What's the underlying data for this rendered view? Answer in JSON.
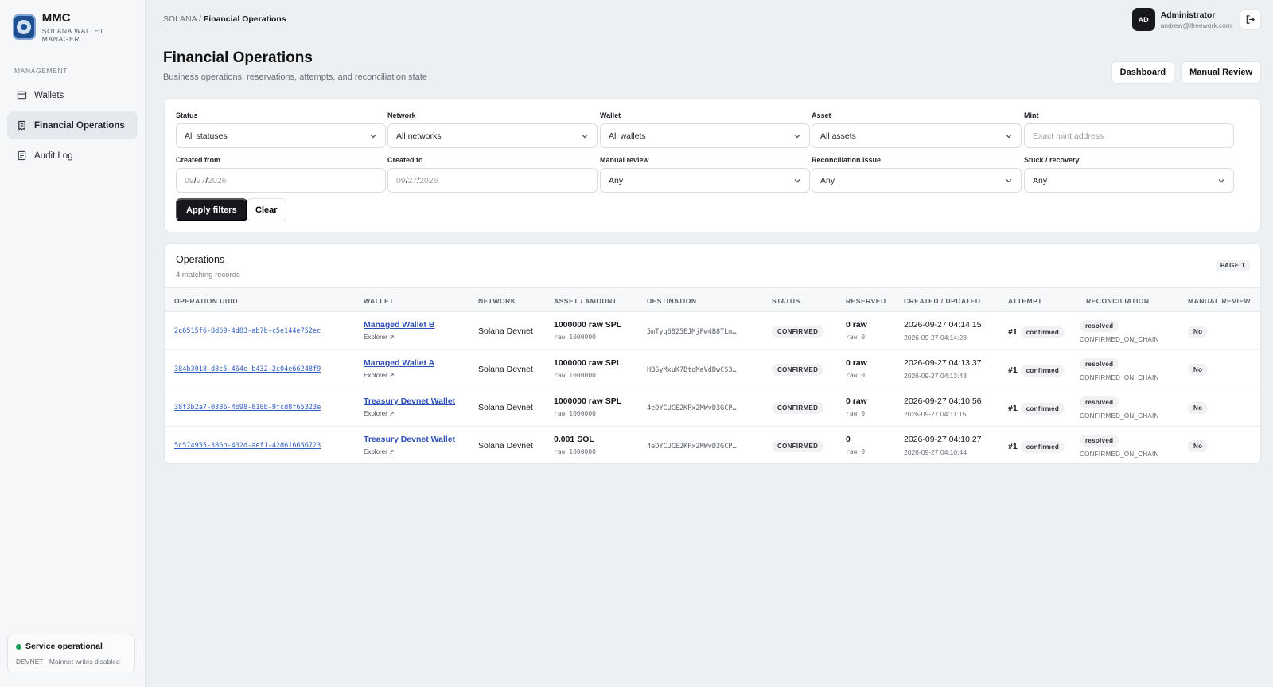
{
  "brand": {
    "title": "MMC",
    "subtitle": "SOLANA WALLET MANAGER"
  },
  "sidebar": {
    "section_label": "MANAGEMENT",
    "items": [
      {
        "label": "Wallets",
        "icon": "wallet-icon",
        "active": false
      },
      {
        "label": "Financial Operations",
        "icon": "receipt-icon",
        "active": true
      },
      {
        "label": "Audit Log",
        "icon": "document-icon",
        "active": false
      }
    ],
    "status": {
      "title": "Service operational",
      "subtitle": "DEVNET · Mainnet writes disabled",
      "color": "#1e9e5a"
    }
  },
  "topbar": {
    "breadcrumb_root": "SOLANA",
    "breadcrumb_sep": " / ",
    "breadcrumb_current": "Financial Operations",
    "user": {
      "initials": "AD",
      "name": "Administrator",
      "email": "andrew@ifreework.com"
    }
  },
  "header": {
    "title": "Financial Operations",
    "subtitle": "Business operations, reservations, attempts, and reconciliation state",
    "dashboard_label": "Dashboard",
    "manual_review_label": "Manual Review"
  },
  "filters": {
    "status": {
      "label": "Status",
      "value": "All statuses"
    },
    "network": {
      "label": "Network",
      "value": "All networks"
    },
    "wallet": {
      "label": "Wallet",
      "value": "All wallets"
    },
    "asset": {
      "label": "Asset",
      "value": "All assets"
    },
    "mint": {
      "label": "Mint",
      "placeholder": "Exact mint address"
    },
    "created_from": {
      "label": "Created from",
      "mm": "09",
      "dd": "27",
      "yyyy": "2026",
      "sep": "/"
    },
    "created_to": {
      "label": "Created to",
      "mm": "09",
      "dd": "27",
      "yyyy": "2026",
      "sep": "/"
    },
    "manual_review": {
      "label": "Manual review",
      "value": "Any"
    },
    "reconciliation_issue": {
      "label": "Reconciliation issue",
      "value": "Any"
    },
    "stuck_recovery": {
      "label": "Stuck / recovery",
      "value": "Any"
    },
    "apply_label": "Apply filters",
    "clear_label": "Clear"
  },
  "operations": {
    "title": "Operations",
    "count_text": "4 matching records",
    "page_label": "PAGE 1",
    "columns": [
      "OPERATION UUID",
      "WALLET",
      "NETWORK",
      "ASSET / AMOUNT",
      "DESTINATION",
      "STATUS",
      "RESERVED",
      "CREATED / UPDATED",
      "ATTEMPT",
      "RECONCILIATION",
      "MANUAL REVIEW"
    ],
    "explorer_label": "Explorer ↗",
    "rows": [
      {
        "uuid": "2c6515f6-8d69-4d83-ab7b-c5e144e752ec",
        "wallet": "Managed Wallet B",
        "network": "Solana Devnet",
        "amount": "1000000 raw SPL",
        "raw": "raw 1000000",
        "destination": "5mTyq6825EJMjPw4B8TLm…",
        "status": "CONFIRMED",
        "reserved": "0 raw",
        "reserved_raw": "raw 0",
        "created": "2026-09-27 04:14:15",
        "updated": "2026-09-27 04:14:28",
        "attempt": "#1",
        "attempt_status": "confirmed",
        "recon": "resolved",
        "recon_sub": "CONFIRMED_ON_CHAIN",
        "manual_review": "No"
      },
      {
        "uuid": "384b3018-d8c5-464e-b432-2c04e66248f9",
        "wallet": "Managed Wallet A",
        "network": "Solana Devnet",
        "amount": "1000000 raw SPL",
        "raw": "raw 1000000",
        "destination": "HBSyMxuK7BtgMaVdDwCS3…",
        "status": "CONFIRMED",
        "reserved": "0 raw",
        "reserved_raw": "raw 0",
        "created": "2026-09-27 04:13:37",
        "updated": "2026-09-27 04:13:48",
        "attempt": "#1",
        "attempt_status": "confirmed",
        "recon": "resolved",
        "recon_sub": "CONFIRMED_ON_CHAIN",
        "manual_review": "No"
      },
      {
        "uuid": "38f3b2a7-0386-4b98-818b-9fcd8f65323e",
        "wallet": "Treasury Devnet Wallet",
        "network": "Solana Devnet",
        "amount": "1000000 raw SPL",
        "raw": "raw 1000000",
        "destination": "4eDYCUCE2KPx2MWvD3GCP…",
        "status": "CONFIRMED",
        "reserved": "0 raw",
        "reserved_raw": "raw 0",
        "created": "2026-09-27 04:10:56",
        "updated": "2026-09-27 04:11:15",
        "attempt": "#1",
        "attempt_status": "confirmed",
        "recon": "resolved",
        "recon_sub": "CONFIRMED_ON_CHAIN",
        "manual_review": "No"
      },
      {
        "uuid": "5c574955-386b-432d-aef1-42d616656723",
        "wallet": "Treasury Devnet Wallet",
        "network": "Solana Devnet",
        "amount": "0.001 SOL",
        "raw": "raw 1000000",
        "destination": "4eDYCUCE2KPx2MWvD3GCP…",
        "status": "CONFIRMED",
        "reserved": "0",
        "reserved_raw": "raw 0",
        "created": "2026-09-27 04:10:27",
        "updated": "2026-09-27 04:10:44",
        "attempt": "#1",
        "attempt_status": "confirmed",
        "recon": "resolved",
        "recon_sub": "CONFIRMED_ON_CHAIN",
        "manual_review": "No"
      }
    ]
  }
}
